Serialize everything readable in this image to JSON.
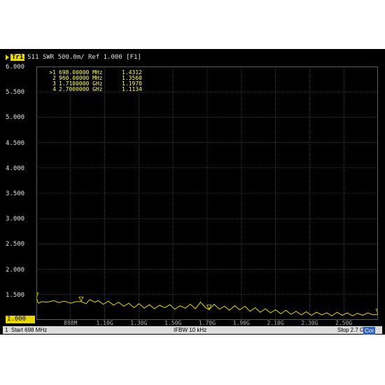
{
  "header": {
    "trace_tag": "Tr1",
    "trace_text": "S11  SWR 500.0m/ Ref 1.000 [F1]"
  },
  "y_ticks": [
    "6.000",
    "5.500",
    "5.000",
    "4.500",
    "4.000",
    "3.500",
    "3.000",
    "2.500",
    "2.000",
    "1.500",
    "1.000"
  ],
  "x_ticks": [
    "898M",
    "1.10G",
    "1.30G",
    "1.50G",
    "1.70G",
    "1.90G",
    "2.10G",
    "2.30G",
    "2.50G"
  ],
  "markers": [
    {
      "id": ">1",
      "freq": "698.00000 MHz",
      "value": "1.4312"
    },
    {
      "id": "2",
      "freq": "960.00000 MHz",
      "value": "1.3560"
    },
    {
      "id": "3",
      "freq": "1.7100000 GHz",
      "value": "1.1970"
    },
    {
      "id": "4",
      "freq": "2.7000000 GHz",
      "value": "1.1134"
    }
  ],
  "status": {
    "channel": "1",
    "start": "Start 698 MHz",
    "ifbw": "IFBW 10 kHz",
    "stop": "Stop 2.7 GHz",
    "cor": "Cor"
  },
  "colors": {
    "trace": "#e8d800",
    "grid": "#5a5a5a",
    "background": "#000000"
  },
  "chart_data": {
    "type": "line",
    "xlim_mhz": [
      698,
      2700
    ],
    "ylim": [
      1.0,
      6.0
    ],
    "marker_points": [
      {
        "x_mhz": 698,
        "y": 1.4312
      },
      {
        "x_mhz": 960,
        "y": 1.356
      },
      {
        "x_mhz": 1710,
        "y": 1.197
      },
      {
        "x_mhz": 2700,
        "y": 1.1134
      }
    ],
    "trace": [
      [
        698,
        1.43
      ],
      [
        710,
        1.33
      ],
      [
        730,
        1.36
      ],
      [
        760,
        1.35
      ],
      [
        800,
        1.38
      ],
      [
        830,
        1.34
      ],
      [
        860,
        1.37
      ],
      [
        900,
        1.33
      ],
      [
        930,
        1.36
      ],
      [
        960,
        1.36
      ],
      [
        990,
        1.32
      ],
      [
        1010,
        1.4
      ],
      [
        1040,
        1.35
      ],
      [
        1060,
        1.38
      ],
      [
        1090,
        1.31
      ],
      [
        1120,
        1.37
      ],
      [
        1150,
        1.29
      ],
      [
        1180,
        1.35
      ],
      [
        1210,
        1.27
      ],
      [
        1240,
        1.33
      ],
      [
        1270,
        1.24
      ],
      [
        1300,
        1.32
      ],
      [
        1330,
        1.23
      ],
      [
        1360,
        1.3
      ],
      [
        1390,
        1.22
      ],
      [
        1420,
        1.29
      ],
      [
        1450,
        1.24
      ],
      [
        1480,
        1.3
      ],
      [
        1510,
        1.21
      ],
      [
        1540,
        1.28
      ],
      [
        1570,
        1.23
      ],
      [
        1600,
        1.31
      ],
      [
        1630,
        1.22
      ],
      [
        1660,
        1.35
      ],
      [
        1690,
        1.24
      ],
      [
        1710,
        1.2
      ],
      [
        1740,
        1.31
      ],
      [
        1770,
        1.21
      ],
      [
        1800,
        1.27
      ],
      [
        1830,
        1.19
      ],
      [
        1860,
        1.28
      ],
      [
        1890,
        1.2
      ],
      [
        1920,
        1.27
      ],
      [
        1950,
        1.17
      ],
      [
        1980,
        1.24
      ],
      [
        2010,
        1.15
      ],
      [
        2040,
        1.22
      ],
      [
        2070,
        1.14
      ],
      [
        2100,
        1.2
      ],
      [
        2130,
        1.12
      ],
      [
        2160,
        1.19
      ],
      [
        2190,
        1.11
      ],
      [
        2220,
        1.17
      ],
      [
        2250,
        1.1
      ],
      [
        2280,
        1.16
      ],
      [
        2310,
        1.09
      ],
      [
        2340,
        1.15
      ],
      [
        2370,
        1.1
      ],
      [
        2400,
        1.14
      ],
      [
        2430,
        1.08
      ],
      [
        2460,
        1.15
      ],
      [
        2490,
        1.09
      ],
      [
        2520,
        1.14
      ],
      [
        2550,
        1.08
      ],
      [
        2580,
        1.13
      ],
      [
        2610,
        1.09
      ],
      [
        2640,
        1.14
      ],
      [
        2670,
        1.1
      ],
      [
        2700,
        1.11
      ]
    ]
  }
}
